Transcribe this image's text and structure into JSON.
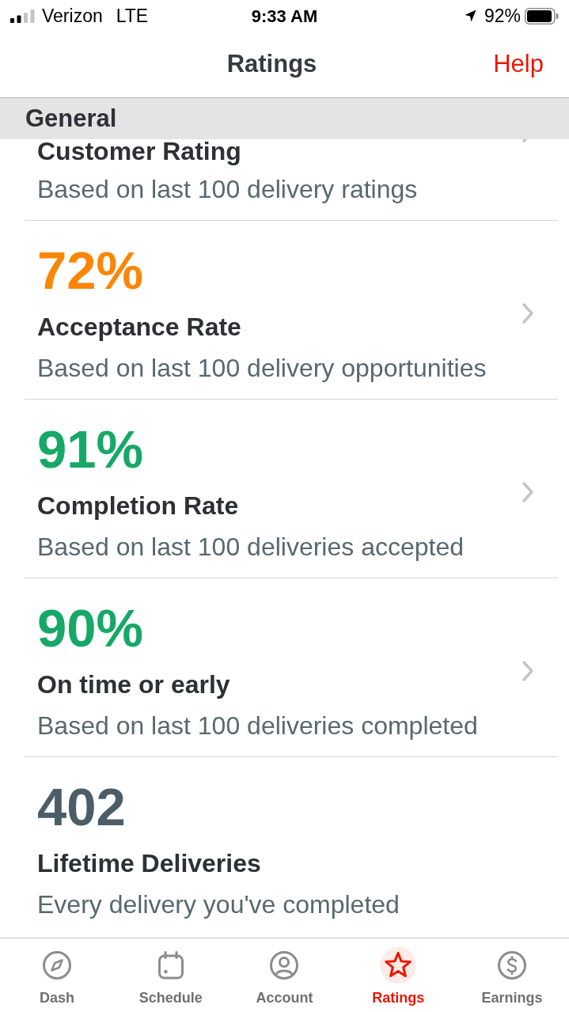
{
  "status_bar": {
    "carrier": "Verizon",
    "network": "LTE",
    "time": "9:33 AM",
    "battery": "92%"
  },
  "nav_bar": {
    "title": "Ratings",
    "action": "Help"
  },
  "section": {
    "title": "General"
  },
  "metrics": [
    {
      "title": "Customer Rating",
      "subtitle": "Based on last 100 delivery ratings",
      "chevron": true,
      "partly_hidden": true
    },
    {
      "value": "72%",
      "color": "#fa8607",
      "title": "Acceptance Rate",
      "subtitle": "Based on last 100 delivery opportunities",
      "chevron": true,
      "partly_hidden": false
    },
    {
      "value": "91%",
      "color": "#17a868",
      "title": "Completion Rate",
      "subtitle": "Based on last 100 deliveries accepted",
      "chevron": true,
      "partly_hidden": false
    },
    {
      "value": "90%",
      "color": "#17a868",
      "title": "On time or early",
      "subtitle": "Based on last 100 deliveries completed",
      "chevron": true,
      "partly_hidden": false
    },
    {
      "value": "402",
      "color": "#4b5e67",
      "title": "Lifetime Deliveries",
      "subtitle": "Every delivery you've completed",
      "chevron": false,
      "partly_hidden": false
    }
  ],
  "tab_bar": [
    {
      "label": "Dash",
      "selected": false
    },
    {
      "label": "Schedule",
      "selected": false
    },
    {
      "label": "Account",
      "selected": false
    },
    {
      "label": "Ratings",
      "selected": true
    },
    {
      "label": "Earnings",
      "selected": false
    }
  ]
}
